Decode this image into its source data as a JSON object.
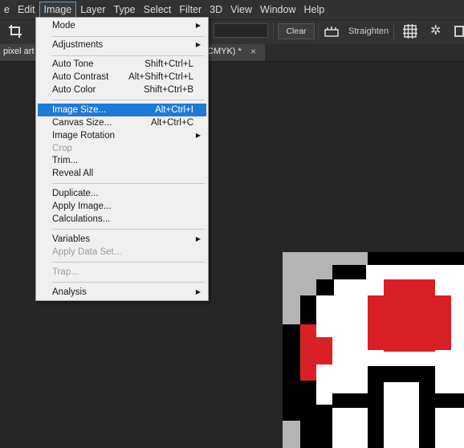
{
  "menubar": {
    "items": [
      "e",
      "Edit",
      "Image",
      "Layer",
      "Type",
      "Select",
      "Filter",
      "3D",
      "View",
      "Window",
      "Help"
    ]
  },
  "options": {
    "clear_label": "Clear",
    "straighten_label": "Straighten"
  },
  "tabs": {
    "tab1_label": "pixel art",
    "tab2_label": "CMYK) *",
    "tab2_close": "×"
  },
  "image_menu": {
    "items": [
      {
        "label": "Mode",
        "shortcut": "",
        "submenu": true,
        "disabled": false
      },
      {
        "label": "Adjustments",
        "shortcut": "",
        "submenu": true,
        "disabled": false
      },
      {
        "label": "Auto Tone",
        "shortcut": "Shift+Ctrl+L",
        "submenu": false,
        "disabled": false
      },
      {
        "label": "Auto Contrast",
        "shortcut": "Alt+Shift+Ctrl+L",
        "submenu": false,
        "disabled": false
      },
      {
        "label": "Auto Color",
        "shortcut": "Shift+Ctrl+B",
        "submenu": false,
        "disabled": false
      },
      {
        "label": "Image Size...",
        "shortcut": "Alt+Ctrl+I",
        "submenu": false,
        "disabled": false
      },
      {
        "label": "Canvas Size...",
        "shortcut": "Alt+Ctrl+C",
        "submenu": false,
        "disabled": false
      },
      {
        "label": "Image Rotation",
        "shortcut": "",
        "submenu": true,
        "disabled": false
      },
      {
        "label": "Crop",
        "shortcut": "",
        "submenu": false,
        "disabled": true
      },
      {
        "label": "Trim...",
        "shortcut": "",
        "submenu": false,
        "disabled": false
      },
      {
        "label": "Reveal All",
        "shortcut": "",
        "submenu": false,
        "disabled": false
      },
      {
        "label": "Duplicate...",
        "shortcut": "",
        "submenu": false,
        "disabled": false
      },
      {
        "label": "Apply Image...",
        "shortcut": "",
        "submenu": false,
        "disabled": false
      },
      {
        "label": "Calculations...",
        "shortcut": "",
        "submenu": false,
        "disabled": false
      },
      {
        "label": "Variables",
        "shortcut": "",
        "submenu": true,
        "disabled": false
      },
      {
        "label": "Apply Data Set...",
        "shortcut": "",
        "submenu": false,
        "disabled": true
      },
      {
        "label": "Trap...",
        "shortcut": "",
        "submenu": false,
        "disabled": true
      },
      {
        "label": "Analysis",
        "shortcut": "",
        "submenu": true,
        "disabled": false
      }
    ]
  },
  "colors": {
    "accent": "#1c7ad8",
    "pixel_red": "#d92027",
    "pixel_grey": "#b4b4b4"
  }
}
